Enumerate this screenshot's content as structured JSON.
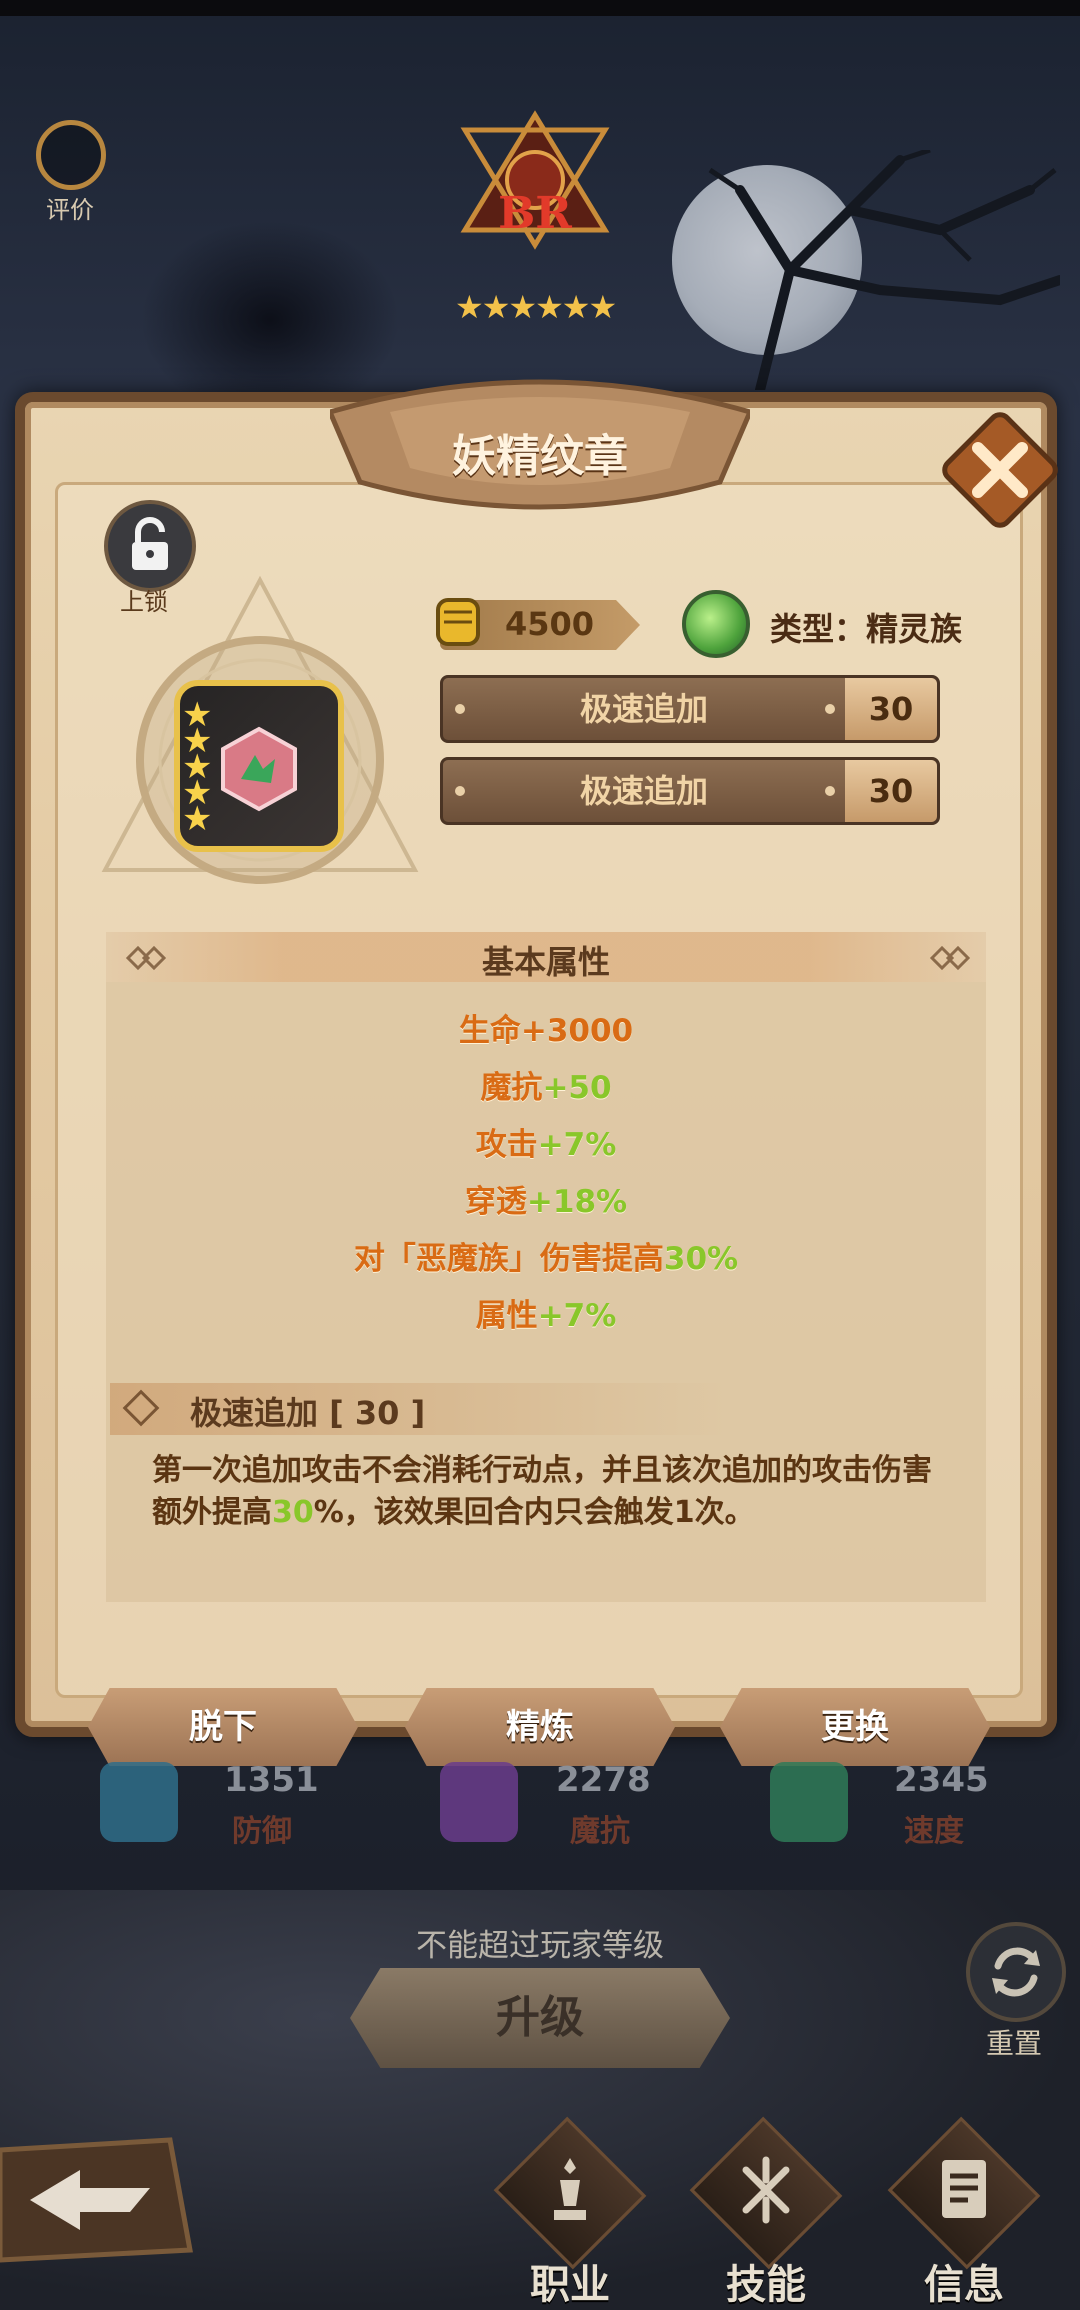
{
  "top": {
    "evaluate_label": "评价",
    "rank_text": "BR",
    "rank_stars": "★★★★★★"
  },
  "panel": {
    "title": "妖精纹章",
    "lock_label": "上锁",
    "power_value": "4500",
    "type_text": "类型：精灵族",
    "emblem_stars": "★\n★\n★\n★\n★",
    "bonuses": [
      {
        "label": "极速追加",
        "value": "30"
      },
      {
        "label": "极速追加",
        "value": "30"
      }
    ],
    "basic_section_title": "基本属性",
    "attributes": [
      {
        "name": "生命",
        "value": "+3000"
      },
      {
        "name": "魔抗",
        "value": "+50"
      },
      {
        "name": "攻击",
        "value": "+7%"
      },
      {
        "name": "穿透",
        "value": "+18%"
      },
      {
        "name": "对「恶魔族」伤害提高",
        "value": "30%"
      },
      {
        "name": "属性",
        "value": "+7%"
      }
    ],
    "skill": {
      "title": "极速追加 [ 30 ]",
      "desc_before": "第一次追加攻击不会消耗行动点，并且该次追加的攻击伤害额外提高",
      "desc_highlight": "30",
      "desc_after": "%，该效果回合内只会触发1次。"
    },
    "actions": {
      "unequip": "脱下",
      "refine": "精炼",
      "replace": "更换"
    }
  },
  "stats": [
    {
      "value": "1351",
      "name": "防御",
      "color": "#2f6d8a"
    },
    {
      "value": "2278",
      "name": "魔抗",
      "color": "#6a3c8c"
    },
    {
      "value": "2345",
      "name": "速度",
      "color": "#2f7a58"
    }
  ],
  "lower": {
    "cap_note": "不能超过玩家等级",
    "upgrade_label": "升级",
    "reset_label": "重置"
  },
  "nav": {
    "class_label": "职业",
    "skill_label": "技能",
    "info_label": "信息"
  },
  "colors": {
    "attr_orange": "#d96b14",
    "attr_green": "#89c72a",
    "panel_bg": "#e9d5b2"
  }
}
